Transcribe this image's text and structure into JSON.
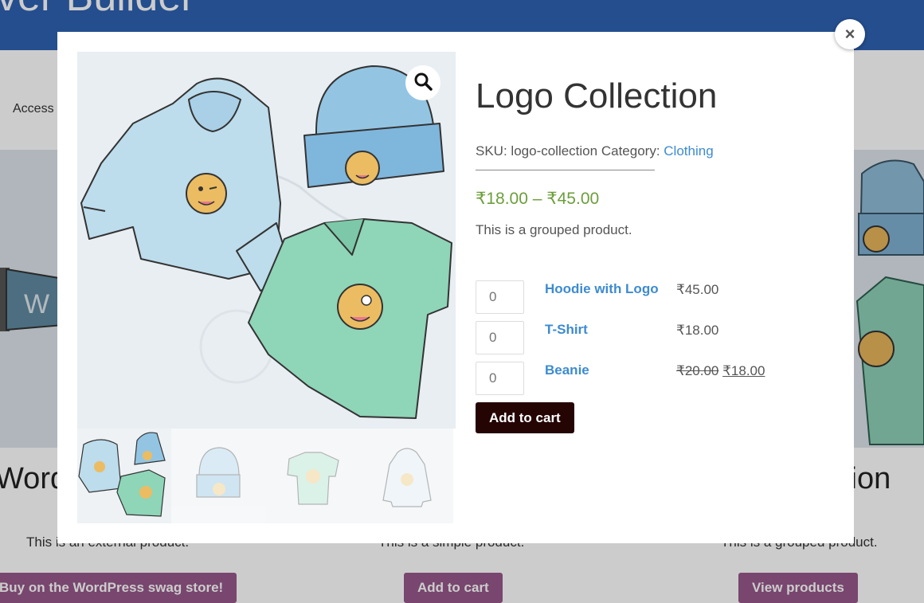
{
  "background": {
    "site_title": "ver Builder",
    "nav_text": "Access",
    "products": [
      {
        "title": "WordP",
        "desc": "This is an external product.",
        "button": "Buy on the WordPress swag store!"
      },
      {
        "title": "",
        "desc": "This is a simple product.",
        "button": "Add to cart"
      },
      {
        "title": "ction",
        "desc": "This is a grouped product.",
        "button": "View products"
      }
    ]
  },
  "modal": {
    "close_label": "×",
    "zoom_icon": "magnifier-icon",
    "product": {
      "title": "Logo Collection",
      "sku_label": "SKU:",
      "sku": "logo-collection",
      "category_label": "Category:",
      "category": "Clothing",
      "price_range": "₹18.00 – ₹45.00",
      "short_description": "This is a grouped product.",
      "grouped_items": [
        {
          "qty": "0",
          "name": "Hoodie with Logo",
          "price": "₹45.00"
        },
        {
          "qty": "0",
          "name": "T-Shirt",
          "price": "₹18.00"
        },
        {
          "qty": "0",
          "name": "Beanie",
          "regular_price": "₹20.00",
          "sale_price": "₹18.00"
        }
      ],
      "add_to_cart": "Add to cart"
    },
    "thumbnails": [
      "logo-collection",
      "beanie",
      "t-shirt",
      "hoodie"
    ]
  },
  "colors": {
    "header_blue": "#2d62b2",
    "link_blue": "#3d8bd0",
    "price_green": "#6c9e3b",
    "button_purple": "#96588a",
    "cart_button": "#250404"
  }
}
